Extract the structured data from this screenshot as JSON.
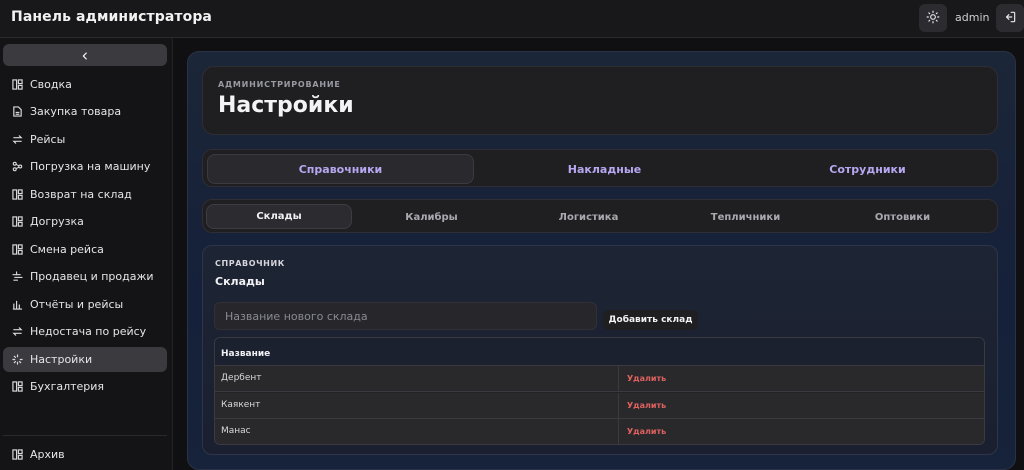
{
  "header": {
    "app_title": "Панель администратора",
    "user": "admin",
    "theme_icon": "sun-icon",
    "logout_icon": "logout-icon"
  },
  "sidebar": {
    "collapse_icon": "chevron-left-icon",
    "items": [
      {
        "label": "Сводка",
        "icon": "dashboard-icon"
      },
      {
        "label": "Закупка товара",
        "icon": "document-icon"
      },
      {
        "label": "Рейсы",
        "icon": "swap-icon"
      },
      {
        "label": "Погрузка на машину",
        "icon": "network-icon"
      },
      {
        "label": "Возврат на склад",
        "icon": "dashboard-icon"
      },
      {
        "label": "Догрузка",
        "icon": "dashboard-icon"
      },
      {
        "label": "Смена рейса",
        "icon": "dashboard-icon"
      },
      {
        "label": "Продавец и продажи",
        "icon": "seller-icon"
      },
      {
        "label": "Отчёты и рейсы",
        "icon": "bar-chart-icon"
      },
      {
        "label": "Недостача по рейсу",
        "icon": "swap-icon"
      },
      {
        "label": "Настройки",
        "icon": "loader-icon",
        "active": true
      },
      {
        "label": "Бухгалтерия",
        "icon": "dashboard-icon"
      }
    ],
    "bottom_item": {
      "label": "Архив",
      "icon": "dashboard-icon"
    }
  },
  "page": {
    "overline": "АДМИНИСТРИРОВАНИЕ",
    "title": "Настройки"
  },
  "tabs_primary": [
    {
      "label": "Справочники",
      "active": true
    },
    {
      "label": "Накладные"
    },
    {
      "label": "Сотрудники"
    }
  ],
  "tabs_secondary": [
    {
      "label": "Склады",
      "active": true
    },
    {
      "label": "Калибры"
    },
    {
      "label": "Логистика"
    },
    {
      "label": "Тепличники"
    },
    {
      "label": "Оптовики"
    }
  ],
  "section": {
    "overline": "СПРАВОЧНИК",
    "title": "Склады",
    "input_placeholder": "Название нового склада",
    "add_button": "Добавить склад"
  },
  "table": {
    "header": "Название",
    "rows": [
      {
        "name": "Дербент",
        "action": "Удалить"
      },
      {
        "name": "Каякент",
        "action": "Удалить"
      },
      {
        "name": "Манас",
        "action": "Удалить"
      }
    ]
  },
  "colors": {
    "accent_purple": "#b7a7f0",
    "danger": "#e0625f"
  }
}
